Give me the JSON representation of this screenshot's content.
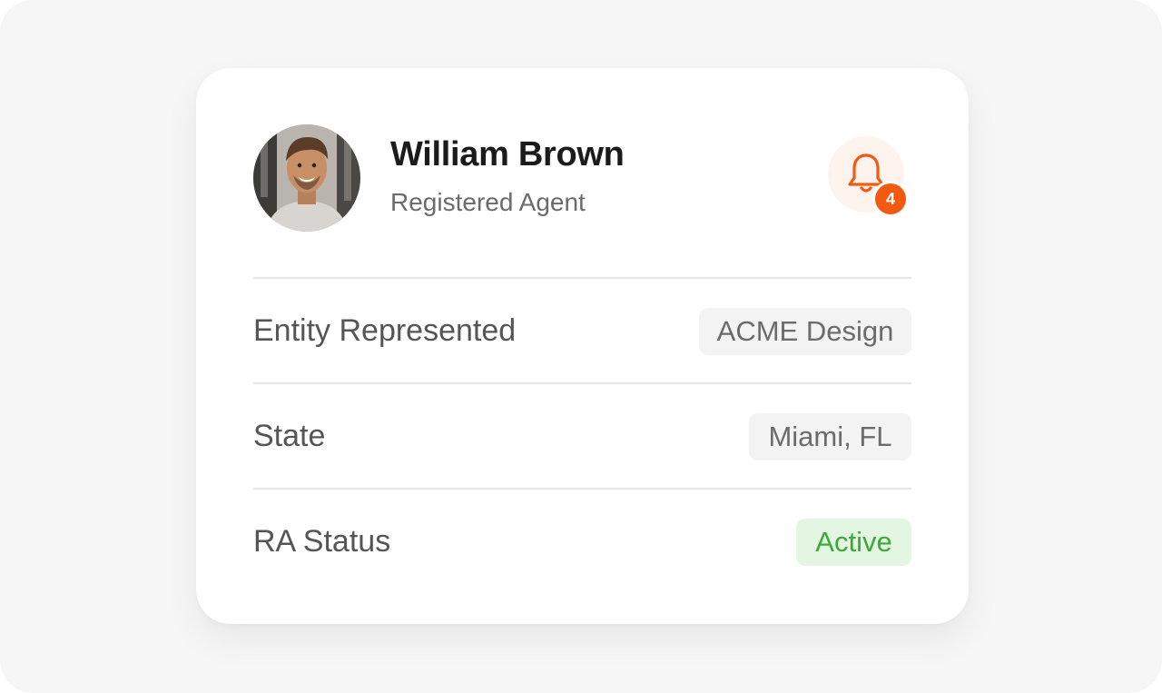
{
  "profile": {
    "name": "William Brown",
    "role": "Registered Agent"
  },
  "notifications": {
    "icon": "bell-icon",
    "count": "4",
    "accent_color": "#f25a12"
  },
  "details": [
    {
      "label": "Entity Represented",
      "value": "ACME Design"
    },
    {
      "label": "State",
      "value": "Miami, FL"
    },
    {
      "label": "RA Status",
      "value": "Active",
      "status_color": "#3fa83a"
    }
  ]
}
